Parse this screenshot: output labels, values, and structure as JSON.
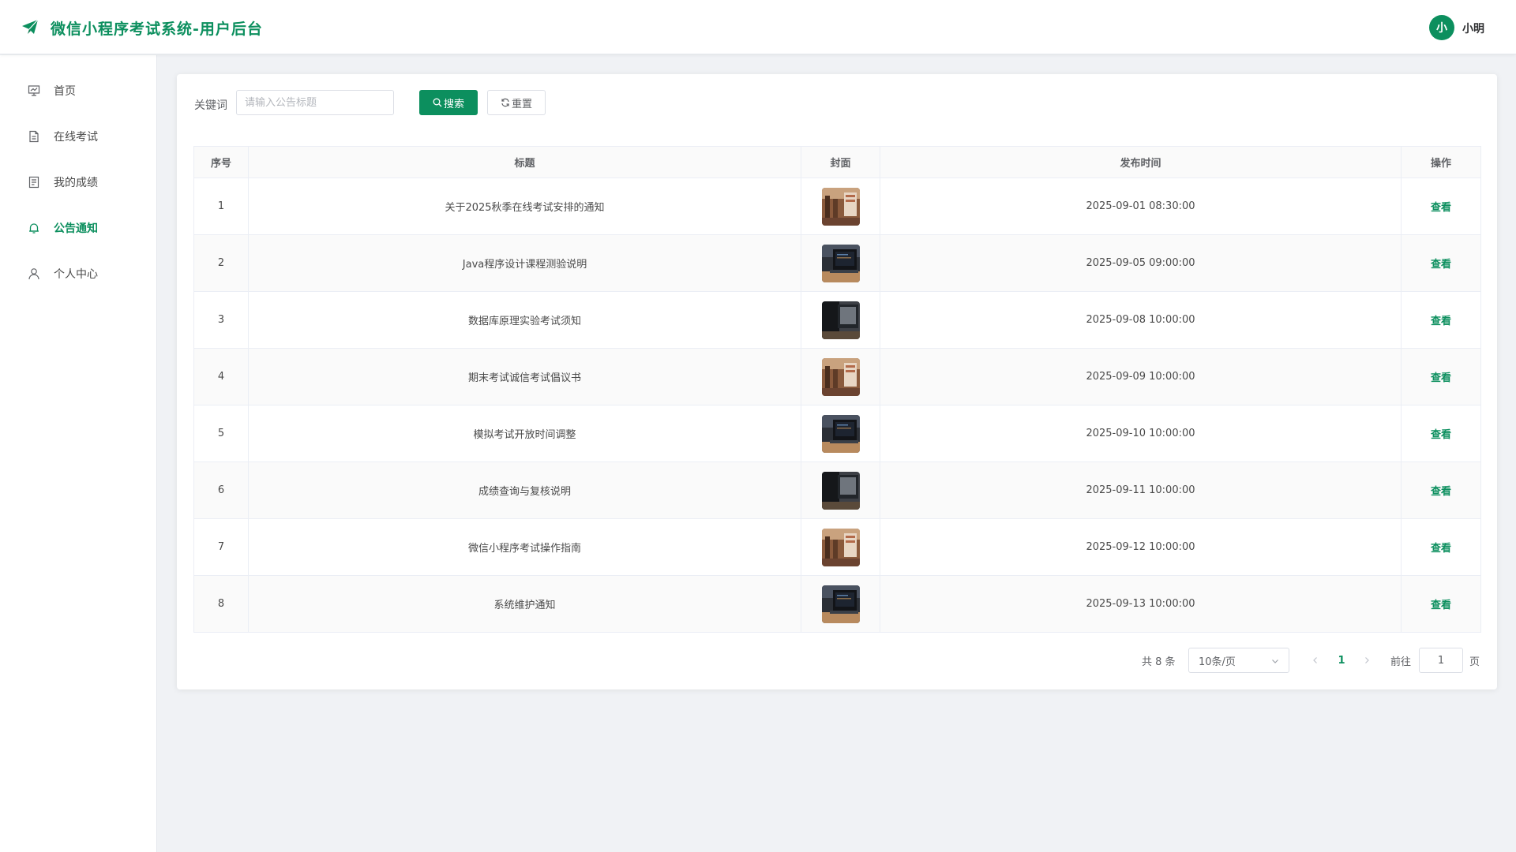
{
  "header": {
    "logo_icon": "paper-plane-icon",
    "title": "微信小程序考试系统-用户后台",
    "avatar_text": "小",
    "username": "小明",
    "accent_color": "#0c8f5e"
  },
  "sidebar": {
    "items": [
      {
        "label": "首页",
        "icon": "presentation-icon",
        "active": false
      },
      {
        "label": "在线考试",
        "icon": "document-icon",
        "active": false
      },
      {
        "label": "我的成绩",
        "icon": "report-icon",
        "active": false
      },
      {
        "label": "公告通知",
        "icon": "bell-icon",
        "active": true
      },
      {
        "label": "个人中心",
        "icon": "user-icon",
        "active": false
      }
    ]
  },
  "search": {
    "label": "关键词",
    "placeholder": "请输入公告标题",
    "value": "",
    "search_button": "搜索",
    "reset_button": "重置"
  },
  "table": {
    "columns": [
      "序号",
      "标题",
      "封面",
      "发布时间",
      "操作"
    ],
    "rows": [
      {
        "index": "1",
        "title": "关于2025秋季在线考试安排的通知",
        "cover": "classroom",
        "time": "2025-09-01 08:30:00",
        "action": "查看"
      },
      {
        "index": "2",
        "title": "Java程序设计课程测验说明",
        "cover": "laptop",
        "time": "2025-09-05 09:00:00",
        "action": "查看"
      },
      {
        "index": "3",
        "title": "数据库原理实验考试须知",
        "cover": "monitor",
        "time": "2025-09-08 10:00:00",
        "action": "查看"
      },
      {
        "index": "4",
        "title": "期末考试诚信考试倡议书",
        "cover": "classroom",
        "time": "2025-09-09 10:00:00",
        "action": "查看"
      },
      {
        "index": "5",
        "title": "模拟考试开放时间调整",
        "cover": "laptop",
        "time": "2025-09-10 10:00:00",
        "action": "查看"
      },
      {
        "index": "6",
        "title": "成绩查询与复核说明",
        "cover": "monitor",
        "time": "2025-09-11 10:00:00",
        "action": "查看"
      },
      {
        "index": "7",
        "title": "微信小程序考试操作指南",
        "cover": "classroom",
        "time": "2025-09-12 10:00:00",
        "action": "查看"
      },
      {
        "index": "8",
        "title": "系统维护通知",
        "cover": "laptop",
        "time": "2025-09-13 10:00:00",
        "action": "查看"
      }
    ]
  },
  "pagination": {
    "total_text": "共 8 条",
    "page_size": "10条/页",
    "current_page": "1",
    "goto_label": "前往",
    "goto_value": "1",
    "page_unit": "页"
  }
}
